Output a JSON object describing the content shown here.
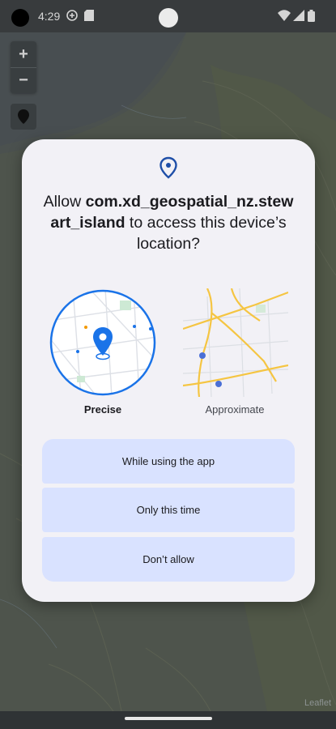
{
  "status_bar": {
    "time": "4:29",
    "icons": [
      "media-icon",
      "sd-card-icon",
      "wifi-icon",
      "signal-icon",
      "battery-icon"
    ]
  },
  "map": {
    "zoom_in_label": "+",
    "zoom_out_label": "−",
    "attribution": "Leaflet"
  },
  "dialog": {
    "icon": "location-pin-icon",
    "title_prefix": "Allow ",
    "app_name": "com.xd_geospatial_nz.stewart_island",
    "title_suffix": " to access this device’s location?",
    "precise_label": "Precise",
    "approximate_label": "Approximate",
    "selected_option": "Precise",
    "buttons": {
      "while_using": "While using the app",
      "only_this_time": "Only this time",
      "dont_allow": "Don’t allow"
    },
    "accent_color": "#1a73e8",
    "button_color": "#d9e2ff"
  }
}
